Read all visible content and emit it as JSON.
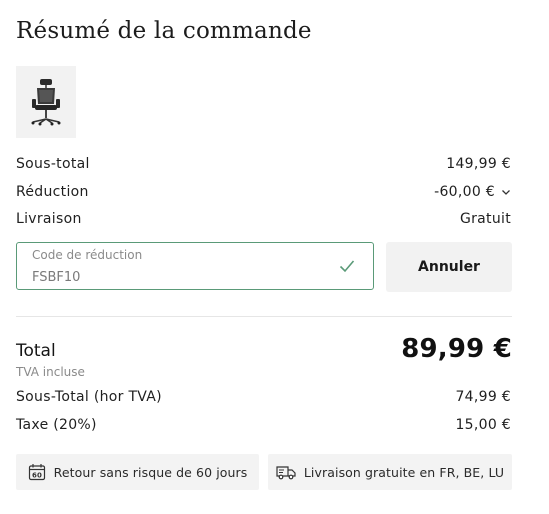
{
  "summary": {
    "title": "Résumé de la commande",
    "product_image": "office-chair-thumbnail",
    "subtotal_label": "Sous-total",
    "subtotal_value": "149,99 €",
    "discount_label": "Réduction",
    "discount_value": "-60,00 €",
    "shipping_label": "Livraison",
    "shipping_value": "Gratuit"
  },
  "promo": {
    "field_label": "Code de réduction",
    "field_value": "FSBF10",
    "valid_icon": "check-icon",
    "cancel_label": "Annuler"
  },
  "totals": {
    "total_label": "Total",
    "total_value": "89,99 €",
    "vat_note": "TVA incluse",
    "net_label": "Sous-Total (hor TVA)",
    "net_value": "74,99 €",
    "tax_label": "Taxe (20%)",
    "tax_value": "15,00 €"
  },
  "badges": {
    "returns_label": "Retour sans risque de 60 jours",
    "returns_icon": "calendar-60-icon",
    "shipping_label": "Livraison gratuite en FR, BE, LU",
    "shipping_icon": "truck-icon"
  },
  "colors": {
    "accent_green": "#5a9a78",
    "muted_bg": "#f2f2f2"
  }
}
